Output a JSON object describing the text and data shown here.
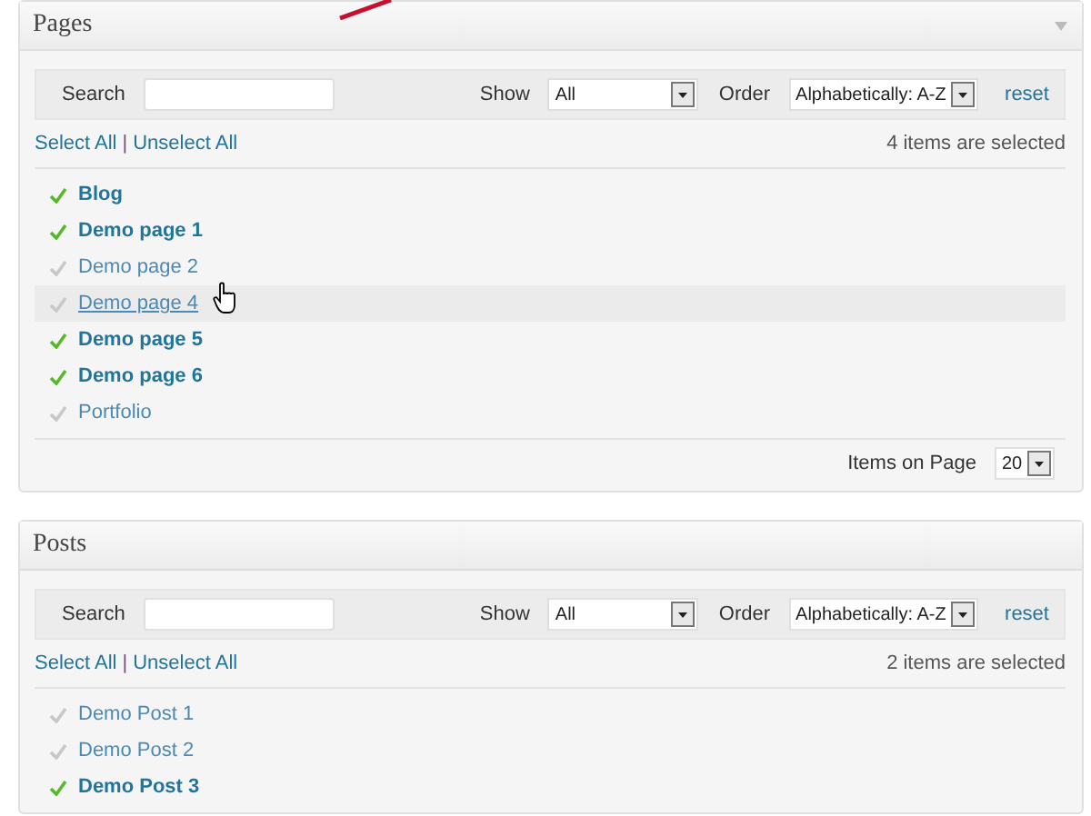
{
  "panels": [
    {
      "title": "Pages",
      "show_toggle": true,
      "search": {
        "label": "Search"
      },
      "show": {
        "label": "Show",
        "value": "All"
      },
      "order": {
        "label": "Order",
        "value": "Alphabetically: A-Z"
      },
      "reset": "reset",
      "select_all": "Select All",
      "separator": "|",
      "unselect_all": "Unselect All",
      "count": "4 items are selected",
      "items": [
        {
          "label": "Blog",
          "selected": true,
          "hovered": false
        },
        {
          "label": "Demo page 1",
          "selected": true,
          "hovered": false
        },
        {
          "label": "Demo page 2",
          "selected": false,
          "hovered": false
        },
        {
          "label": "Demo page 4",
          "selected": false,
          "hovered": true
        },
        {
          "label": "Demo page 5",
          "selected": true,
          "hovered": false
        },
        {
          "label": "Demo page 6",
          "selected": true,
          "hovered": false
        },
        {
          "label": "Portfolio",
          "selected": false,
          "hovered": false
        }
      ],
      "footer": {
        "label": "Items on Page",
        "value": "20"
      }
    },
    {
      "title": "Posts",
      "show_toggle": false,
      "search": {
        "label": "Search"
      },
      "show": {
        "label": "Show",
        "value": "All"
      },
      "order": {
        "label": "Order",
        "value": "Alphabetically: A-Z"
      },
      "reset": "reset",
      "select_all": "Select All",
      "separator": "|",
      "unselect_all": "Unselect All",
      "count": "2 items are selected",
      "items": [
        {
          "label": "Demo Post 1",
          "selected": false,
          "hovered": false
        },
        {
          "label": "Demo Post 2",
          "selected": false,
          "hovered": false
        },
        {
          "label": "Demo Post 3",
          "selected": true,
          "hovered": false
        }
      ]
    }
  ]
}
